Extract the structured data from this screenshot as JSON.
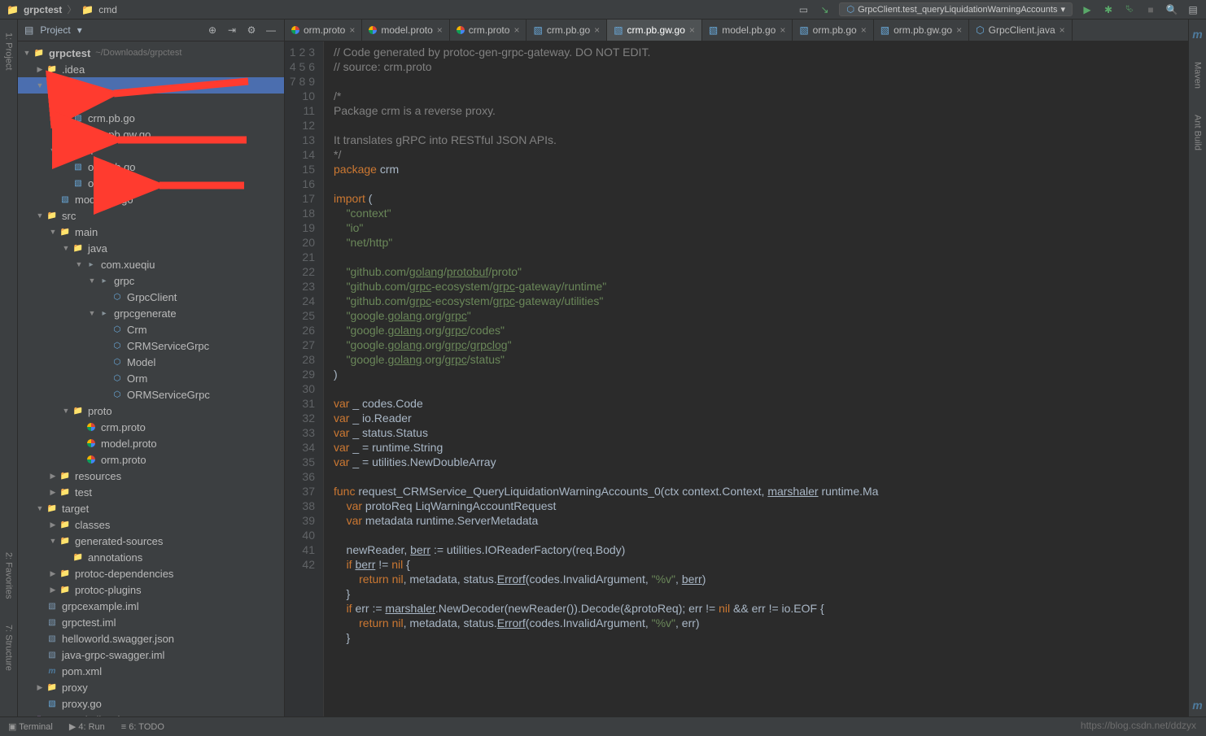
{
  "breadcrumb": {
    "root": "grpctest",
    "path": "cmd"
  },
  "runConfig": "GrpcClient.test_queryLiquidationWarningAccounts",
  "projectPanel": {
    "title": "Project"
  },
  "tree": {
    "root": {
      "name": "grpctest",
      "hint": "~/Downloads/grpctest"
    },
    "items": [
      {
        "d": 1,
        "t": "folder",
        "n": ".idea",
        "a": "r"
      },
      {
        "d": 1,
        "t": "folder",
        "n": "cmd",
        "a": "d",
        "sel": true
      },
      {
        "d": 2,
        "t": "folder",
        "n": "crm",
        "a": "d"
      },
      {
        "d": 3,
        "t": "go",
        "n": "crm.pb.go"
      },
      {
        "d": 3,
        "t": "go",
        "n": "crm.pb.gw.go"
      },
      {
        "d": 2,
        "t": "folder",
        "n": "orm",
        "a": "d"
      },
      {
        "d": 3,
        "t": "go",
        "n": "orm.pb.go"
      },
      {
        "d": 3,
        "t": "go",
        "n": "orm.pb.gw.go"
      },
      {
        "d": 2,
        "t": "go",
        "n": "model.pb.go"
      },
      {
        "d": 1,
        "t": "folder",
        "n": "src",
        "a": "d"
      },
      {
        "d": 2,
        "t": "folder",
        "n": "main",
        "a": "d"
      },
      {
        "d": 3,
        "t": "folder",
        "n": "java",
        "a": "d"
      },
      {
        "d": 4,
        "t": "pkg",
        "n": "com.xueqiu",
        "a": "d"
      },
      {
        "d": 5,
        "t": "pkg",
        "n": "grpc",
        "a": "d"
      },
      {
        "d": 6,
        "t": "java",
        "n": "GrpcClient"
      },
      {
        "d": 5,
        "t": "pkg",
        "n": "grpcgenerate",
        "a": "d"
      },
      {
        "d": 6,
        "t": "java",
        "n": "Crm"
      },
      {
        "d": 6,
        "t": "java",
        "n": "CRMServiceGrpc"
      },
      {
        "d": 6,
        "t": "java",
        "n": "Model"
      },
      {
        "d": 6,
        "t": "java",
        "n": "Orm"
      },
      {
        "d": 6,
        "t": "java",
        "n": "ORMServiceGrpc"
      },
      {
        "d": 3,
        "t": "folder",
        "n": "proto",
        "a": "d"
      },
      {
        "d": 4,
        "t": "proto",
        "n": "crm.proto"
      },
      {
        "d": 4,
        "t": "proto",
        "n": "model.proto"
      },
      {
        "d": 4,
        "t": "proto",
        "n": "orm.proto"
      },
      {
        "d": 2,
        "t": "folder-o",
        "n": "resources",
        "a": "r"
      },
      {
        "d": 2,
        "t": "folder",
        "n": "test",
        "a": "r"
      },
      {
        "d": 1,
        "t": "folder-o",
        "n": "target",
        "a": "d"
      },
      {
        "d": 2,
        "t": "folder-o",
        "n": "classes",
        "a": "r"
      },
      {
        "d": 2,
        "t": "folder-o",
        "n": "generated-sources",
        "a": "d"
      },
      {
        "d": 3,
        "t": "folder-o",
        "n": "annotations"
      },
      {
        "d": 2,
        "t": "folder-o",
        "n": "protoc-dependencies",
        "a": "r"
      },
      {
        "d": 2,
        "t": "folder-o",
        "n": "protoc-plugins",
        "a": "r"
      },
      {
        "d": 1,
        "t": "file",
        "n": "grpcexample.iml"
      },
      {
        "d": 1,
        "t": "file",
        "n": "grpctest.iml"
      },
      {
        "d": 1,
        "t": "file",
        "n": "helloworld.swagger.json"
      },
      {
        "d": 1,
        "t": "file",
        "n": "java-grpc-swagger.iml"
      },
      {
        "d": 1,
        "t": "maven",
        "n": "pom.xml"
      },
      {
        "d": 1,
        "t": "folder",
        "n": "proxy",
        "a": "r"
      },
      {
        "d": 1,
        "t": "go",
        "n": "proxy.go"
      },
      {
        "d": 0,
        "t": "lib",
        "n": "External Libraries",
        "a": "r"
      }
    ]
  },
  "tabs": [
    {
      "icon": "proto",
      "label": "orm.proto"
    },
    {
      "icon": "proto",
      "label": "model.proto"
    },
    {
      "icon": "proto",
      "label": "crm.proto"
    },
    {
      "icon": "go",
      "label": "crm.pb.go"
    },
    {
      "icon": "go",
      "label": "crm.pb.gw.go",
      "active": true
    },
    {
      "icon": "go",
      "label": "model.pb.go"
    },
    {
      "icon": "go",
      "label": "orm.pb.go"
    },
    {
      "icon": "go",
      "label": "orm.pb.gw.go"
    },
    {
      "icon": "java",
      "label": "GrpcClient.java"
    }
  ],
  "code": {
    "start": 1,
    "lines": [
      "// Code generated by protoc-gen-grpc-gateway. DO NOT EDIT.",
      "// source: crm.proto",
      "",
      "/*",
      "Package crm is a reverse proxy.",
      "",
      "It translates gRPC into RESTful JSON APIs.",
      "*/",
      "package crm",
      "",
      "import (",
      "    \"context\"",
      "    \"io\"",
      "    \"net/http\"",
      "",
      "    \"github.com/golang/protobuf/proto\"",
      "    \"github.com/grpc-ecosystem/grpc-gateway/runtime\"",
      "    \"github.com/grpc-ecosystem/grpc-gateway/utilities\"",
      "    \"google.golang.org/grpc\"",
      "    \"google.golang.org/grpc/codes\"",
      "    \"google.golang.org/grpc/grpclog\"",
      "    \"google.golang.org/grpc/status\"",
      ")",
      "",
      "var _ codes.Code",
      "var _ io.Reader",
      "var _ status.Status",
      "var _ = runtime.String",
      "var _ = utilities.NewDoubleArray",
      "",
      "func request_CRMService_QueryLiquidationWarningAccounts_0(ctx context.Context, marshaler runtime.Ma",
      "    var protoReq LiqWarningAccountRequest",
      "    var metadata runtime.ServerMetadata",
      "",
      "    newReader, berr := utilities.IOReaderFactory(req.Body)",
      "    if berr != nil {",
      "        return nil, metadata, status.Errorf(codes.InvalidArgument, \"%v\", berr)",
      "    }",
      "    if err := marshaler.NewDecoder(newReader()).Decode(&protoReq); err != nil && err != io.EOF {",
      "        return nil, metadata, status.Errorf(codes.InvalidArgument, \"%v\", err)",
      "    }",
      ""
    ]
  },
  "leftTools": {
    "project": "1: Project",
    "structure": "7: Structure",
    "favorites": "2: Favorites"
  },
  "rightTools": {
    "maven": "Maven",
    "ant": "Ant Build"
  },
  "bottomTools": {
    "terminal": "Terminal",
    "run": "4: Run",
    "todo": "6: TODO"
  },
  "watermark": "https://blog.csdn.net/ddzyx"
}
